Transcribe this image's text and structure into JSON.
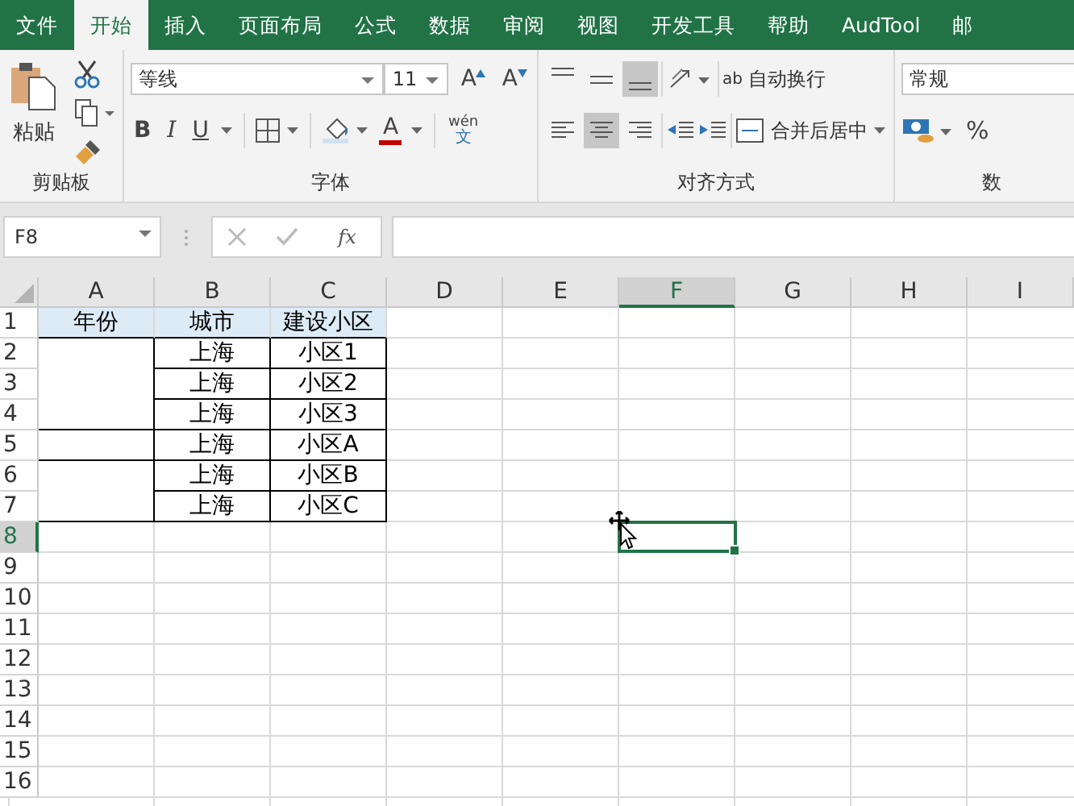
{
  "ribbon_tabs": [
    {
      "label": "文件",
      "selected": false
    },
    {
      "label": "开始",
      "selected": true
    },
    {
      "label": "插入",
      "selected": false
    },
    {
      "label": "页面布局",
      "selected": false
    },
    {
      "label": "公式",
      "selected": false
    },
    {
      "label": "数据",
      "selected": false
    },
    {
      "label": "审阅",
      "selected": false
    },
    {
      "label": "视图",
      "selected": false
    },
    {
      "label": "开发工具",
      "selected": false
    },
    {
      "label": "帮助",
      "selected": false
    },
    {
      "label": "AudTool",
      "selected": false
    },
    {
      "label": "邮",
      "selected": false
    }
  ],
  "clipboard": {
    "paste": "粘贴",
    "group_label": "剪贴板"
  },
  "font": {
    "name": "等线",
    "size": "11",
    "grow": "A",
    "shrink": "A",
    "bold": "B",
    "italic": "I",
    "underline": "U",
    "font_color": "A",
    "phonetic_top": "wén",
    "phonetic_bottom": "文",
    "group_label": "字体"
  },
  "alignment": {
    "vertical": [
      {
        "selected": false
      },
      {
        "selected": false
      },
      {
        "selected": true
      }
    ],
    "horizontal": [
      {
        "selected": false
      },
      {
        "selected": true
      },
      {
        "selected": false
      }
    ],
    "wrap_text_icon": "ab",
    "wrap_text": "自动换行",
    "merge_center": "合并后居中",
    "group_label": "对齐方式"
  },
  "number": {
    "format": "常规",
    "percent": "%",
    "group_label": "数"
  },
  "formula_bar": {
    "name_box": "F8",
    "fx": "fx"
  },
  "sheet": {
    "columns": [
      {
        "label": "A",
        "selected": false
      },
      {
        "label": "B",
        "selected": false
      },
      {
        "label": "C",
        "selected": false
      },
      {
        "label": "D",
        "selected": false
      },
      {
        "label": "E",
        "selected": false
      },
      {
        "label": "F",
        "selected": true
      },
      {
        "label": "G",
        "selected": false
      },
      {
        "label": "H",
        "selected": false
      },
      {
        "label": "I",
        "selected": false
      }
    ],
    "rows": [
      {
        "label": "1",
        "selected": false
      },
      {
        "label": "2",
        "selected": false
      },
      {
        "label": "3",
        "selected": false
      },
      {
        "label": "4",
        "selected": false
      },
      {
        "label": "5",
        "selected": false
      },
      {
        "label": "6",
        "selected": false
      },
      {
        "label": "7",
        "selected": false
      },
      {
        "label": "8",
        "selected": true
      },
      {
        "label": "9",
        "selected": false
      },
      {
        "label": "10",
        "selected": false
      },
      {
        "label": "11",
        "selected": false
      },
      {
        "label": "12",
        "selected": false
      },
      {
        "label": "13",
        "selected": false
      },
      {
        "label": "14",
        "selected": false
      },
      {
        "label": "15",
        "selected": false
      },
      {
        "label": "16",
        "selected": false
      }
    ],
    "table": {
      "header": [
        "年份",
        "城市",
        "建设小区"
      ],
      "rows": [
        {
          "year_group_start": true,
          "city": "上海",
          "district": "小区1"
        },
        {
          "year_group_start": false,
          "city": "上海",
          "district": "小区2"
        },
        {
          "year_group_start": false,
          "city": "上海",
          "district": "小区3"
        },
        {
          "year_group_start": true,
          "city": "上海",
          "district": "小区A"
        },
        {
          "year_group_start": true,
          "city": "上海",
          "district": "小区B"
        },
        {
          "year_group_start": false,
          "city": "上海",
          "district": "小区C"
        }
      ]
    }
  }
}
